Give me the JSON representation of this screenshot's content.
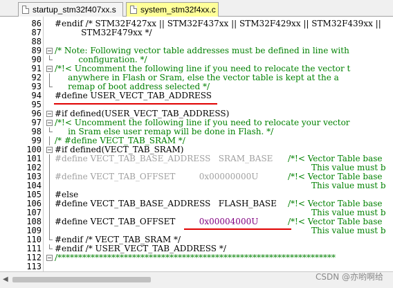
{
  "tabs": [
    {
      "label": "startup_stm32f407xx.s",
      "active": false
    },
    {
      "label": "system_stm32f4xx.c",
      "active": true
    }
  ],
  "code_lines": [
    {
      "num": "86",
      "text": "#endif /* STM32F427xx || STM32F437xx || STM32F429xx || STM32F439xx ||"
    },
    {
      "num": "87",
      "text": "          STM32F479xx */"
    },
    {
      "num": "88",
      "text": ""
    },
    {
      "num": "89",
      "text": "/* Note: Following vector table addresses must be defined in line with"
    },
    {
      "num": "90",
      "text": "         configuration. */"
    },
    {
      "num": "91",
      "text": "/*!< Uncomment the following line if you need to relocate the vector t"
    },
    {
      "num": "92",
      "text": "     anywhere in Flash or Sram, else the vector table is kept at the a"
    },
    {
      "num": "93",
      "text": "     remap of boot address selected */"
    },
    {
      "num": "94",
      "text": "#define USER_VECT_TAB_ADDRESS"
    },
    {
      "num": "95",
      "text": ""
    },
    {
      "num": "96",
      "text": "#if defined(USER_VECT_TAB_ADDRESS)"
    },
    {
      "num": "97",
      "text": "/*!< Uncomment the following line if you need to relocate your vector"
    },
    {
      "num": "98",
      "text": "     in Sram else user remap will be done in Flash. */"
    },
    {
      "num": "99",
      "text": "/* #define VECT_TAB_SRAM */"
    },
    {
      "num": "100",
      "text": "#if defined(VECT_TAB_SRAM)"
    },
    {
      "num": "101",
      "text": "#define VECT_TAB_BASE_ADDRESS   SRAM_BASE"
    },
    {
      "num": "102",
      "text": ""
    },
    {
      "num": "103",
      "text": "#define VECT_TAB_OFFSET         0x00000000U"
    },
    {
      "num": "104",
      "text": ""
    },
    {
      "num": "105",
      "text": "#else"
    },
    {
      "num": "106",
      "text": "#define VECT_TAB_BASE_ADDRESS   FLASH_BASE"
    },
    {
      "num": "107",
      "text": ""
    },
    {
      "num": "108",
      "text": "#define VECT_TAB_OFFSET         0x00004000U"
    },
    {
      "num": "109",
      "text": ""
    },
    {
      "num": "110",
      "text": "#endif /* VECT_TAB_SRAM */"
    },
    {
      "num": "111",
      "text": "#endif /* USER_VECT_TAB_ADDRESS */"
    },
    {
      "num": "112",
      "text": "/*******************************************************************"
    },
    {
      "num": "113",
      "text": ""
    }
  ],
  "side_comments": {
    "c101": "/*!< Vector Table base",
    "c102": "This value must b",
    "c103": "/*!< Vector Table base",
    "c104": "This value must b",
    "c106": "/*!< Vector Table base",
    "c107": "This value must b",
    "c108": "/*!< Vector Table base",
    "c109": "This value must b"
  },
  "watermark": "CSDN @亦哟啊给",
  "colors": {
    "comment": "#008000",
    "inactive": "#a0a0a0",
    "number": "#800080",
    "highlight_line": "#e00000",
    "active_tab": "#ffff99"
  }
}
